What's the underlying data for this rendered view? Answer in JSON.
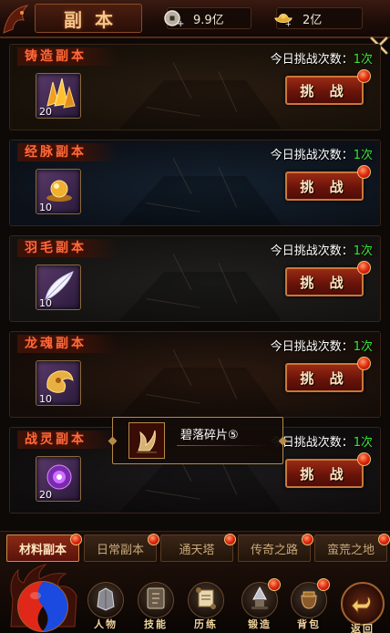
{
  "header": {
    "title": "副本",
    "silver_amount": "9.9亿",
    "gold_amount": "2亿",
    "silver_icon": "silver-coin-icon",
    "gold_icon": "gold-ingot-icon"
  },
  "attempts_label": "今日挑战次数：",
  "challenge_label": "挑 战",
  "rows": [
    {
      "name": "铸造副本",
      "item_count": "20",
      "attempts": "1次",
      "item_icon": "gold-crystal-icon"
    },
    {
      "name": "经脉副本",
      "item_count": "10",
      "attempts": "1次",
      "item_icon": "golden-orb-icon"
    },
    {
      "name": "羽毛副本",
      "item_count": "10",
      "attempts": "1次",
      "item_icon": "white-feather-icon"
    },
    {
      "name": "龙魂副本",
      "item_count": "10",
      "attempts": "1次",
      "item_icon": "dragon-soul-icon"
    },
    {
      "name": "战灵副本",
      "item_count": "20",
      "attempts": "1次",
      "item_icon": "purple-spirit-icon"
    }
  ],
  "tooltip": {
    "item_name": "碧落碎片⑤",
    "icon": "fragment-icon"
  },
  "tabs": [
    {
      "label": "材料副本",
      "active": true
    },
    {
      "label": "日常副本",
      "active": false
    },
    {
      "label": "通天塔",
      "active": false
    },
    {
      "label": "传奇之路",
      "active": false
    },
    {
      "label": "蛮荒之地",
      "active": false
    }
  ],
  "bottom_nav": [
    {
      "label": "人物",
      "icon": "armor-icon"
    },
    {
      "label": "技能",
      "icon": "skill-book-icon"
    },
    {
      "label": "历练",
      "icon": "scroll-icon"
    },
    {
      "label": "锻造",
      "icon": "anvil-icon"
    },
    {
      "label": "背包",
      "icon": "bag-icon"
    }
  ],
  "return_label": "返回",
  "colors": {
    "attempts_count": "#39e839",
    "dungeon_name": "#ff6a3a",
    "button_red": "#8a2214",
    "border_gold": "#c9783a"
  }
}
